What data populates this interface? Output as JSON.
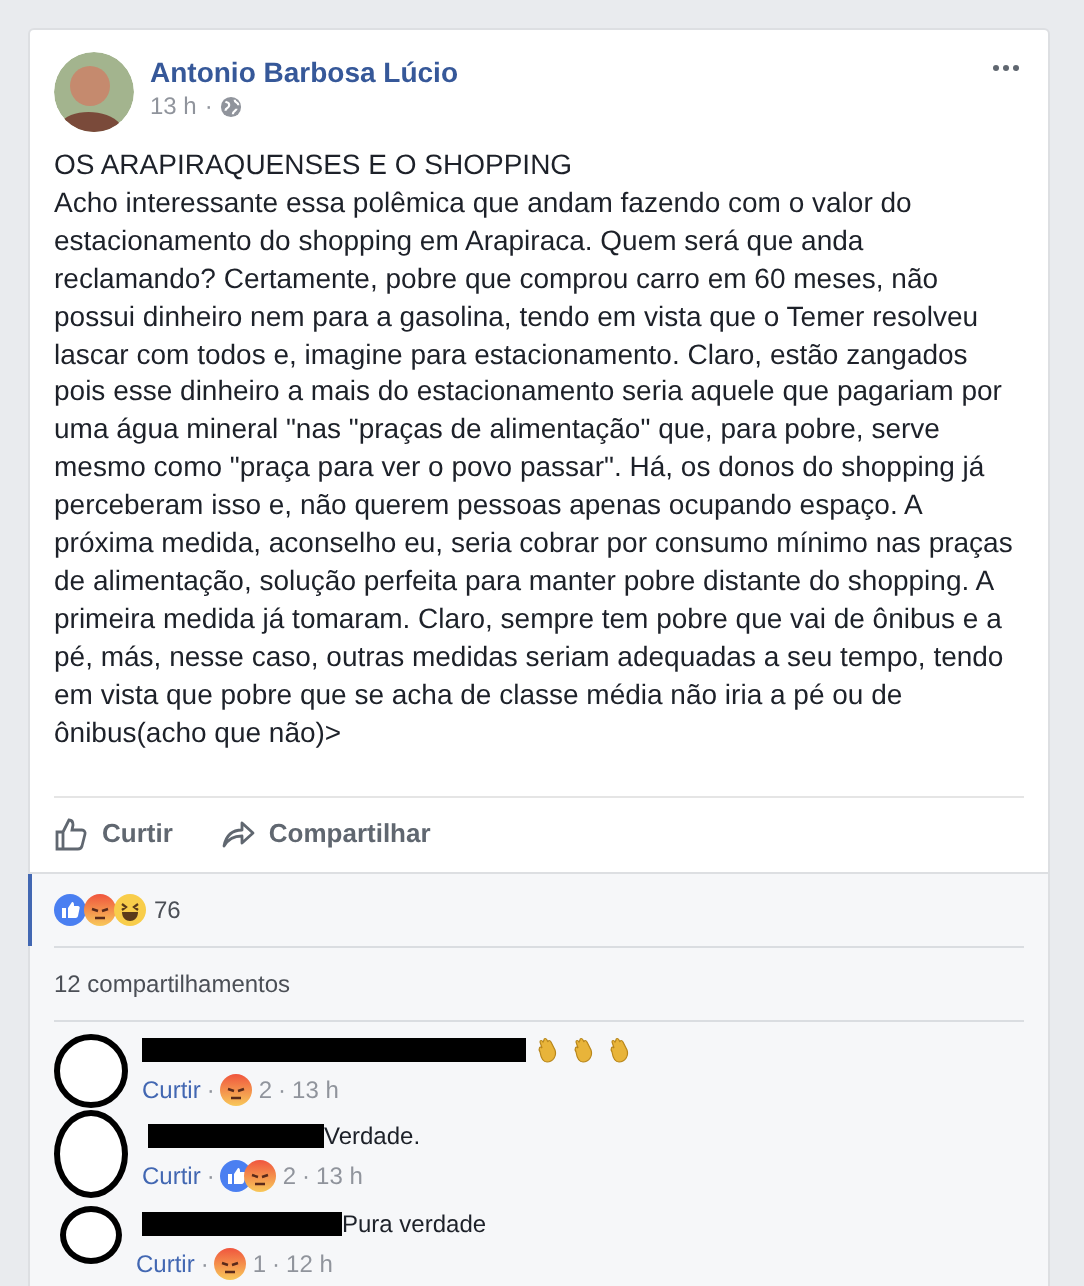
{
  "post": {
    "author": "Antonio Barbosa Lúcio",
    "time": "13 h",
    "separator": "·",
    "title": "OS ARAPIRAQUENSES E O SHOPPING",
    "body": "Acho interessante essa polêmica que andam fazendo com o valor do estacionamento do shopping em Arapiraca. Quem será que anda reclamando? Certamente, pobre que comprou carro em 60 meses, não possui dinheiro nem para a gasolina, tendo em vista que o Temer resolveu lascar com todos e, imagine para estacionamento. Claro, estão zangados pois esse dinheiro a mais do estacionamento seria aquele que pagariam por uma água mineral \"nas \"praças de alimentação\" que, para pobre, serve mesmo como \"praça para ver o povo passar\". Há, os donos do shopping já perceberam isso e, não querem pessoas apenas ocupando espaço. A próxima medida, aconselho eu, seria cobrar por consumo mínimo nas praças de alimentação, solução perfeita para manter pobre distante do shopping. A primeira medida já tomaram. Claro, sempre tem pobre que vai de ônibus e a pé, más, nesse caso, outras medidas seriam adequadas a seu tempo, tendo em vista que pobre que se acha de classe média não iria a pé ou de ônibus(acho que não)>"
  },
  "actions": [
    {
      "kind": "like",
      "label": "Curtir"
    },
    {
      "kind": "share",
      "label": "Compartilhar"
    }
  ],
  "reactions": {
    "types": [
      {
        "kind": "like"
      },
      {
        "kind": "angry"
      },
      {
        "kind": "haha"
      }
    ],
    "count": "76"
  },
  "shares": "12 compartilhamentos",
  "comments": [
    {
      "emoji": [
        {
          "kind": "clap"
        },
        {
          "kind": "clap"
        },
        {
          "kind": "clap"
        }
      ],
      "like_label": "Curtir",
      "reactions": [
        {
          "kind": "angry"
        }
      ],
      "count": "2",
      "time": "13 h"
    },
    {
      "text": "Verdade.",
      "like_label": "Curtir",
      "reactions": [
        {
          "kind": "like"
        },
        {
          "kind": "angry"
        }
      ],
      "count": "2",
      "time": "13 h"
    },
    {
      "text": "Pura verdade",
      "like_label": "Curtir",
      "reactions": [
        {
          "kind": "angry"
        }
      ],
      "count": "1",
      "time": "12 h"
    }
  ]
}
